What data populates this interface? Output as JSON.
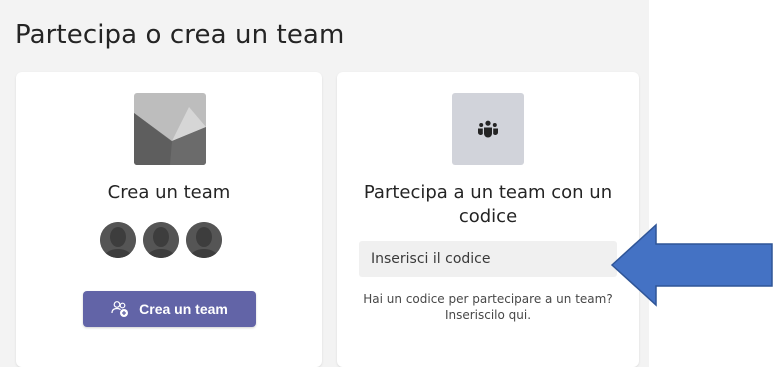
{
  "page": {
    "title": "Partecipa o crea un team"
  },
  "create_card": {
    "title": "Crea un team",
    "button_label": "Crea un team",
    "button_icon": "add-people-icon",
    "image_icon": "team-placeholder-image",
    "avatar_count": 3
  },
  "join_card": {
    "title": "Partecipa a un team con un codice",
    "icon": "teams-people-icon",
    "input_placeholder": "Inserisci il codice",
    "help_text_line1": "Hai un codice per partecipare a un team?",
    "help_text_line2": "Inseriscilo qui."
  },
  "colors": {
    "accent": "#6264a7",
    "panel_background": "#f3f3f3",
    "arrow_fill": "#4472c4",
    "arrow_stroke": "#2f5597"
  },
  "annotation": {
    "icon": "arrow-left-icon"
  }
}
